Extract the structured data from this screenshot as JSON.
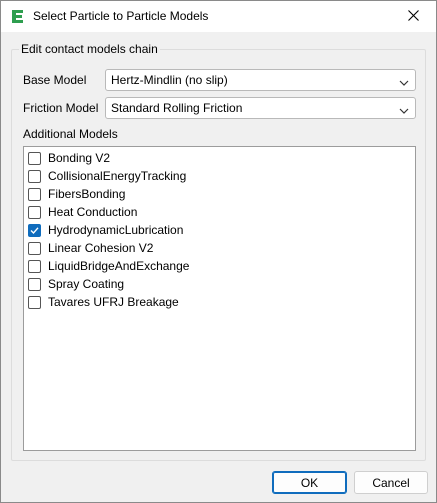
{
  "window": {
    "title": "Select Particle to Particle Models",
    "app_icon": "edem-logo-icon",
    "close_icon": "close-icon"
  },
  "group": {
    "title": "Edit contact models chain"
  },
  "base_model": {
    "label": "Base Model",
    "value": "Hertz-Mindlin (no slip)"
  },
  "friction_model": {
    "label": "Friction Model",
    "value": "Standard Rolling Friction"
  },
  "additional_models": {
    "label": "Additional Models",
    "items": [
      {
        "label": "Bonding V2",
        "checked": false
      },
      {
        "label": "CollisionalEnergyTracking",
        "checked": false
      },
      {
        "label": "FibersBonding",
        "checked": false
      },
      {
        "label": "Heat Conduction",
        "checked": false
      },
      {
        "label": "HydrodynamicLubrication",
        "checked": true
      },
      {
        "label": "Linear Cohesion V2",
        "checked": false
      },
      {
        "label": "LiquidBridgeAndExchange",
        "checked": false
      },
      {
        "label": "Spray Coating",
        "checked": false
      },
      {
        "label": "Tavares UFRJ Breakage",
        "checked": false
      }
    ]
  },
  "buttons": {
    "ok": "OK",
    "cancel": "Cancel"
  },
  "colors": {
    "accent": "#0f6cbd",
    "app_icon": "#2e9e4f"
  }
}
